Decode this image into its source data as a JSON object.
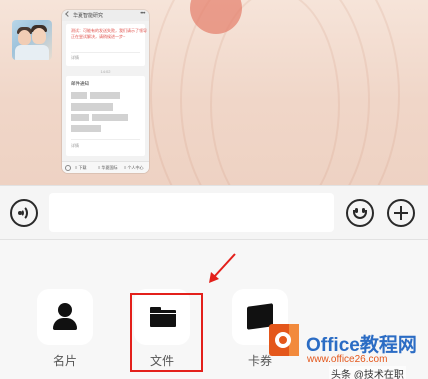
{
  "chat": {
    "screenshot": {
      "title": "华夏智能研究",
      "more": "•••",
      "card1_red": [
        "测试：可能有的发送失败，我们请示了领导",
        "正在尝试解决，请稍候进一步~"
      ],
      "card1_small": "详情",
      "time": "14:02",
      "card2_title": "邮件通知",
      "card2_small": "详情",
      "bottom_tabs": [
        "≡ 下载",
        "≡ 华夏国际",
        "≡ 个人中心"
      ]
    }
  },
  "toolbar": {
    "voice_icon": "voice-icon",
    "emoji_icon": "emoji-icon",
    "plus_icon": "plus-icon"
  },
  "panel": {
    "items": [
      {
        "label": "名片",
        "icon": "person-icon"
      },
      {
        "label": "文件",
        "icon": "folder-icon"
      },
      {
        "label": "卡券",
        "icon": "card-icon"
      }
    ],
    "highlight_color": "#e3201b"
  },
  "watermark": {
    "title": "Office教程网",
    "url": "www.office26.com",
    "source": "头条 @技术在职"
  }
}
